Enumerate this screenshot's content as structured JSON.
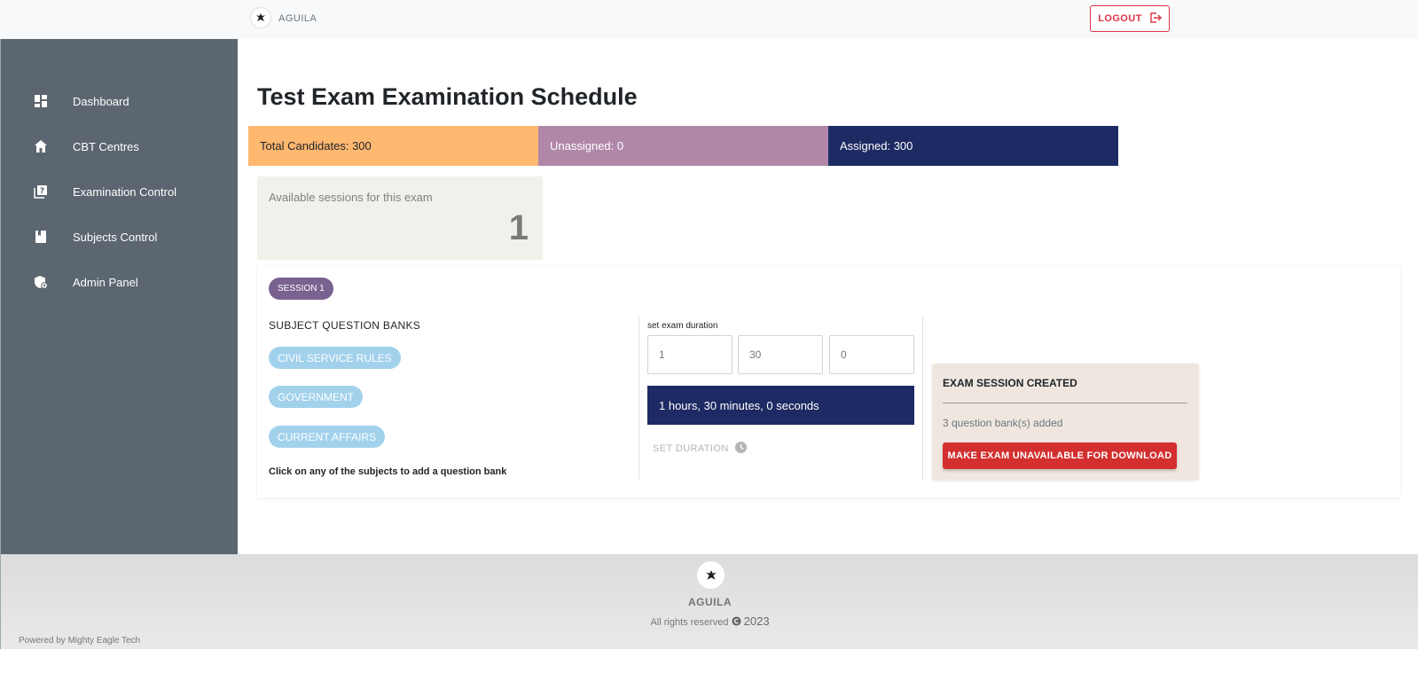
{
  "topbar": {
    "brand": "AGUILA",
    "logout_label": "LOGOUT"
  },
  "sidebar": {
    "items": [
      {
        "label": "Dashboard",
        "icon": "dashboard-icon"
      },
      {
        "label": "CBT Centres",
        "icon": "home-icon"
      },
      {
        "label": "Examination Control",
        "icon": "quiz-icon"
      },
      {
        "label": "Subjects Control",
        "icon": "book-icon"
      },
      {
        "label": "Admin Panel",
        "icon": "admin-shield-icon"
      }
    ]
  },
  "page": {
    "title": "Test Exam Examination Schedule"
  },
  "stats": {
    "total": "Total Candidates: 300",
    "unassigned": "Unassigned: 0",
    "assigned": "Assigned: 300",
    "colors": {
      "total": "#ffb870",
      "unassigned": "#b087a9",
      "assigned": "#1e2a63"
    }
  },
  "sessions": {
    "label": "Available sessions for this exam",
    "count": "1"
  },
  "session": {
    "pill": "SESSION 1",
    "question_banks_title": "SUBJECT QUESTION BANKS",
    "subjects": [
      "CIVIL SERVICE RULES",
      "GOVERNMENT",
      "CURRENT AFFAIRS"
    ],
    "hint": "Click on any of the subjects to add a question bank",
    "duration": {
      "label": "set exam duration",
      "hours_placeholder": "1",
      "minutes_placeholder": "30",
      "seconds_placeholder": "0",
      "summary": "1 hours, 30 minutes, 0 seconds",
      "set_label": "SET DURATION"
    },
    "created": {
      "title": "EXAM SESSION CREATED",
      "info": "3 question bank(s) added",
      "button": "MAKE EXAM UNAVAILABLE FOR DOWNLOAD"
    }
  },
  "footer": {
    "brand": "AGUILA",
    "rights": "All rights reserved",
    "year": "2023",
    "powered": "Powered by Mighty Eagle Tech"
  }
}
